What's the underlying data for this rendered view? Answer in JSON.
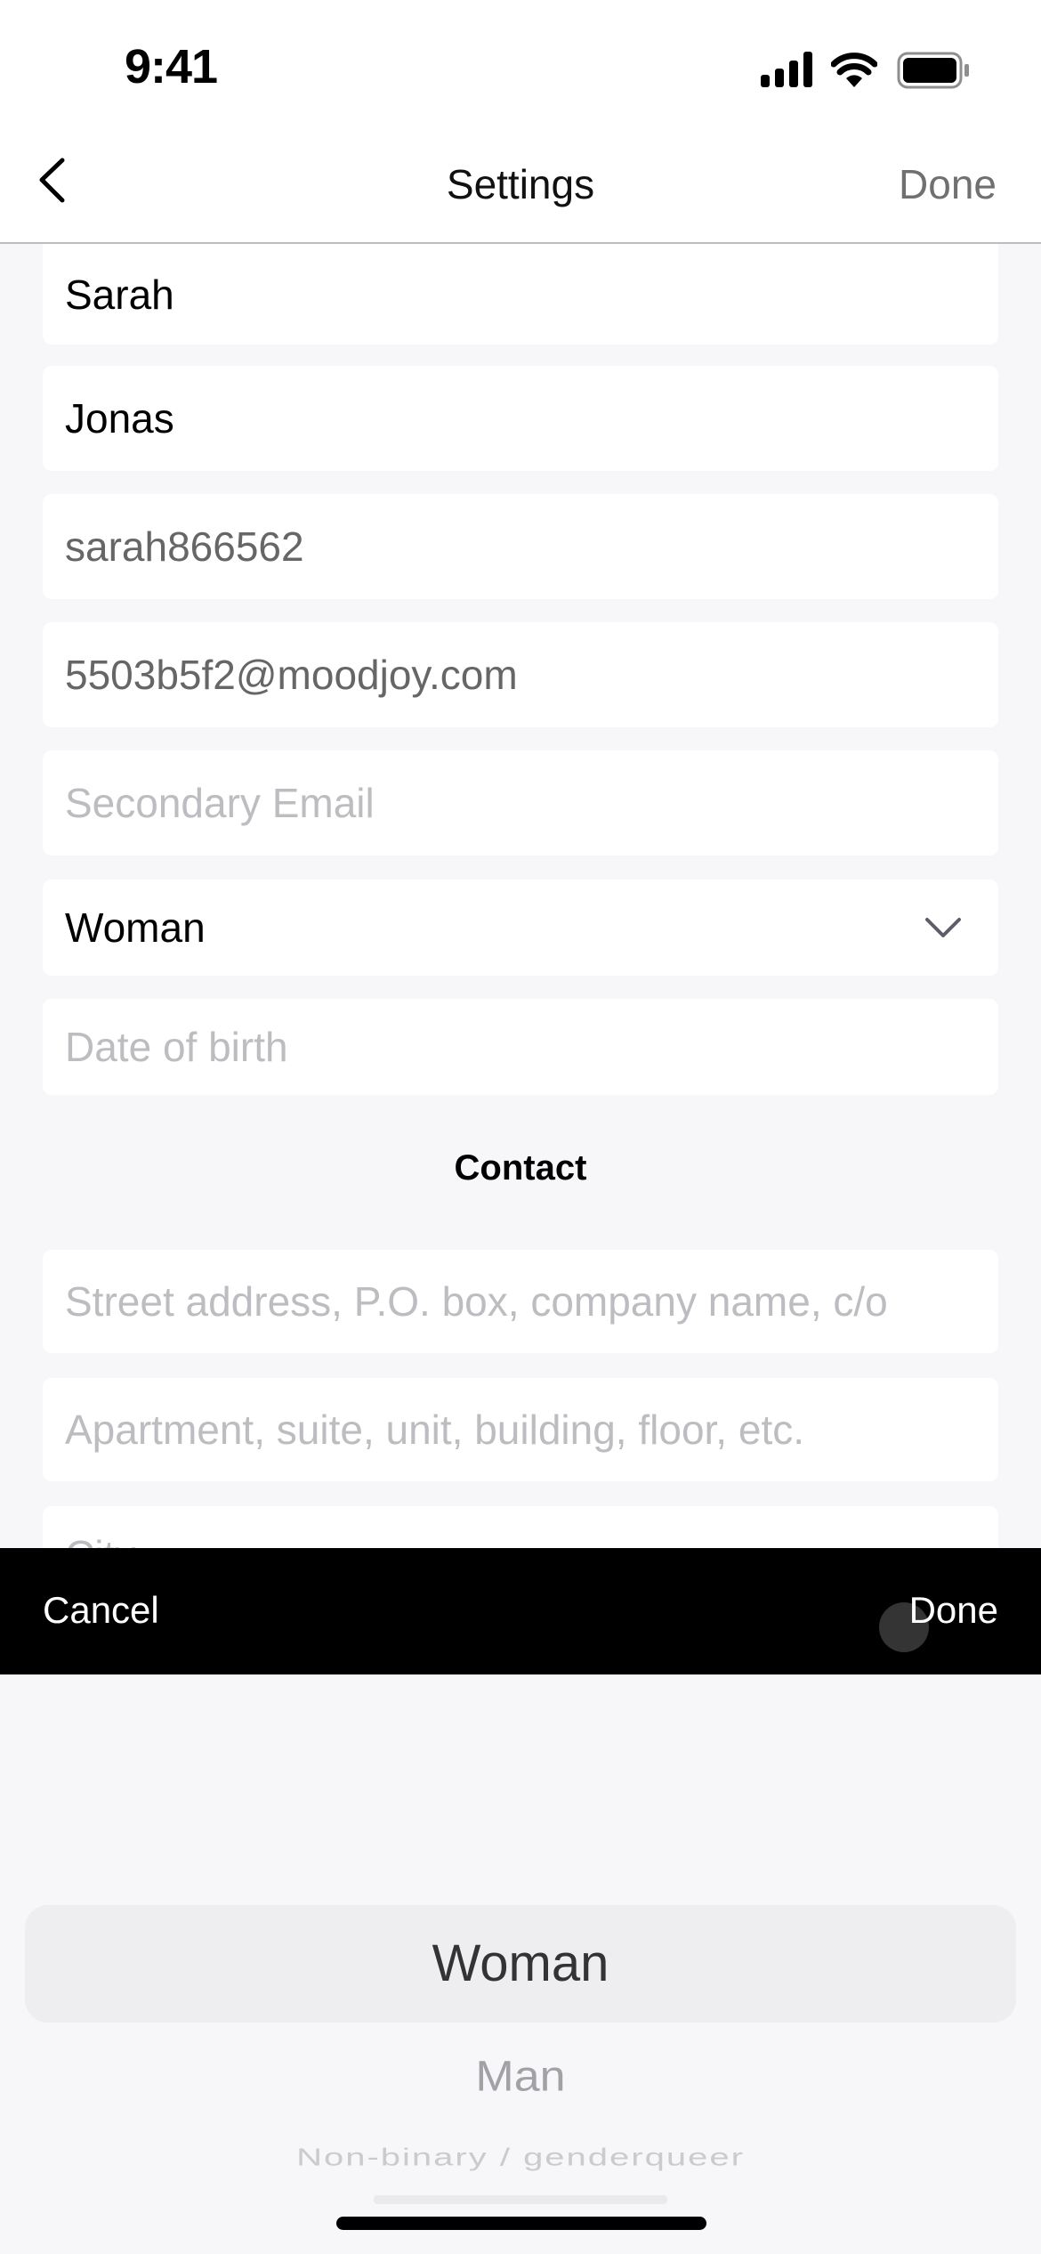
{
  "status_bar": {
    "time": "9:41",
    "icons": [
      "cellular-signal-icon",
      "wifi-icon",
      "battery-icon"
    ]
  },
  "nav": {
    "title": "Settings",
    "back_icon": "chevron-left-icon",
    "done_label": "Done"
  },
  "fields": {
    "first_name": {
      "value": "Sarah"
    },
    "last_name": {
      "value": "Jonas"
    },
    "username": {
      "value": "sarah866562"
    },
    "email": {
      "value": "5503b5f2@moodjoy.com"
    },
    "secondary_email": {
      "placeholder": "Secondary Email"
    },
    "gender": {
      "value": "Woman",
      "icon": "chevron-down-icon"
    },
    "date_of_birth": {
      "placeholder": "Date of birth"
    }
  },
  "contact": {
    "section_title": "Contact",
    "street": {
      "placeholder": "Street address, P.O. box, company name, c/o"
    },
    "apartment": {
      "placeholder": "Apartment, suite, unit, building, floor, etc."
    },
    "city": {
      "placeholder": "City"
    }
  },
  "picker_toolbar": {
    "cancel_label": "Cancel",
    "done_label": "Done"
  },
  "picker": {
    "selected": "Woman",
    "options": [
      "Woman",
      "Man",
      "Non-binary / genderqueer"
    ]
  }
}
